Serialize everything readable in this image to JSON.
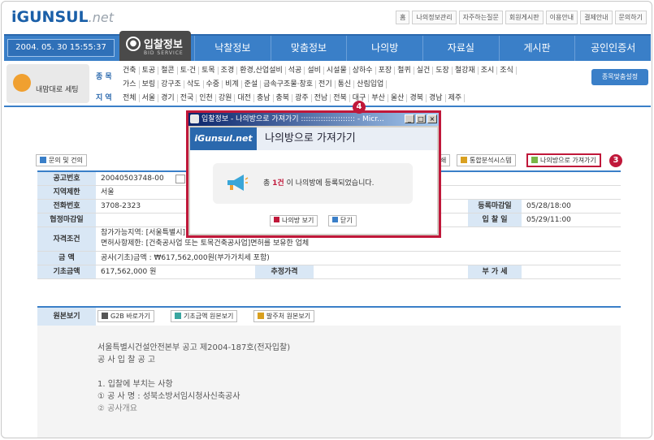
{
  "header": {
    "logo_main": "iGUNSUL",
    "logo_net": ".net",
    "top_links": [
      "홈",
      "나의정보관리",
      "자주하는질문",
      "회원게시판",
      "이용안내",
      "결제안내",
      "문의하기"
    ]
  },
  "nav": {
    "datetime": "2004. 05. 30  15:55:37",
    "active_tab": "입찰정보",
    "active_tab_sub": "BID  SERVICE",
    "items": [
      "낙찰정보",
      "맞춤정보",
      "나의방",
      "자료실",
      "게시판",
      "공인인증서"
    ]
  },
  "category": {
    "my_menu": "내맘대로 세팅",
    "label_type": "종 목",
    "label_region": "지 역",
    "row1": [
      "건축",
      "토공",
      "철콘",
      "토·건",
      "토목",
      "조경",
      "환경,산업설비",
      "석공",
      "설비",
      "시설물",
      "상하수",
      "포장",
      "철퀴",
      "실건",
      "도장",
      "철강재",
      "조시",
      "조식"
    ],
    "row2": [
      "가스",
      "보링",
      "강구조",
      "삭도",
      "수중",
      "비계",
      "준설",
      "금속구조물·창호",
      "전기",
      "통신",
      "산림입업"
    ],
    "regions": [
      "전체",
      "서울",
      "경기",
      "전국",
      "인천",
      "강원",
      "대전",
      "충남",
      "충북",
      "광주",
      "전남",
      "전북",
      "대구",
      "부산",
      "울산",
      "경북",
      "경남",
      "제주"
    ],
    "item_setting": "종목맞춤설정"
  },
  "actions": {
    "inquiry": "문의 및 건의",
    "print": "쇄",
    "analysis": "통합분석시스템",
    "go_myroom": "나의방으로 가져가기"
  },
  "badges": {
    "step3": "3",
    "step4": "4"
  },
  "table": {
    "announce_no_label": "공고번호",
    "announce_no": "20040503748-00",
    "region_limit_label": "지역제한",
    "region_limit": "서울",
    "phone_label": "전화번호",
    "phone": "3708-2323",
    "reg_deadline_label": "등록마감일",
    "reg_deadline": "05/28/18:00",
    "consult_deadline_label": "협정마감일",
    "bid_date_label": "입 찰 일",
    "bid_date": "05/29/11:00",
    "qualification_label": "자격조건",
    "qualification_1": "참가가능지역: [서울특별시]",
    "qualification_2": "면허사항제한: [건축공사업 또는 토목건축공사업]면허를 보유한 업체",
    "amount_label": "금   액",
    "amount": "공사(기초)금액 : ₩617,562,000원(부가가치세 포함)",
    "base_amount_label": "기초금액",
    "base_amount": "617,562,000 원",
    "est_price_label": "추정가격",
    "vat_label": "부 가 세"
  },
  "original": {
    "label": "원본보기",
    "g2b": "G2B 바로가기",
    "base_doc": "기초금액 원본보기",
    "client_doc": "발주처 원본보기",
    "lines": [
      "서울특별시건설안전본부 공고 제2004-187호(전자입찰)",
      "공 사 입 찰 공 고",
      "1. 입찰에 부치는 사항",
      "① 공 사 명 : 성북소방서임시청사신축공사",
      "② 공사개요"
    ]
  },
  "popup": {
    "window_title": "입찰정보 - 나의방으로 가져가기 :::::::::::::::::::::: - Micr...",
    "logo": "iGunsul.net",
    "header_text": "나의방으로 가져가기",
    "msg_prefix": "총 ",
    "msg_count": "1건",
    "msg_suffix": " 이 나의방에 등록되었습니다.",
    "btn_view": "나의방 보기",
    "btn_close": "닫기"
  }
}
